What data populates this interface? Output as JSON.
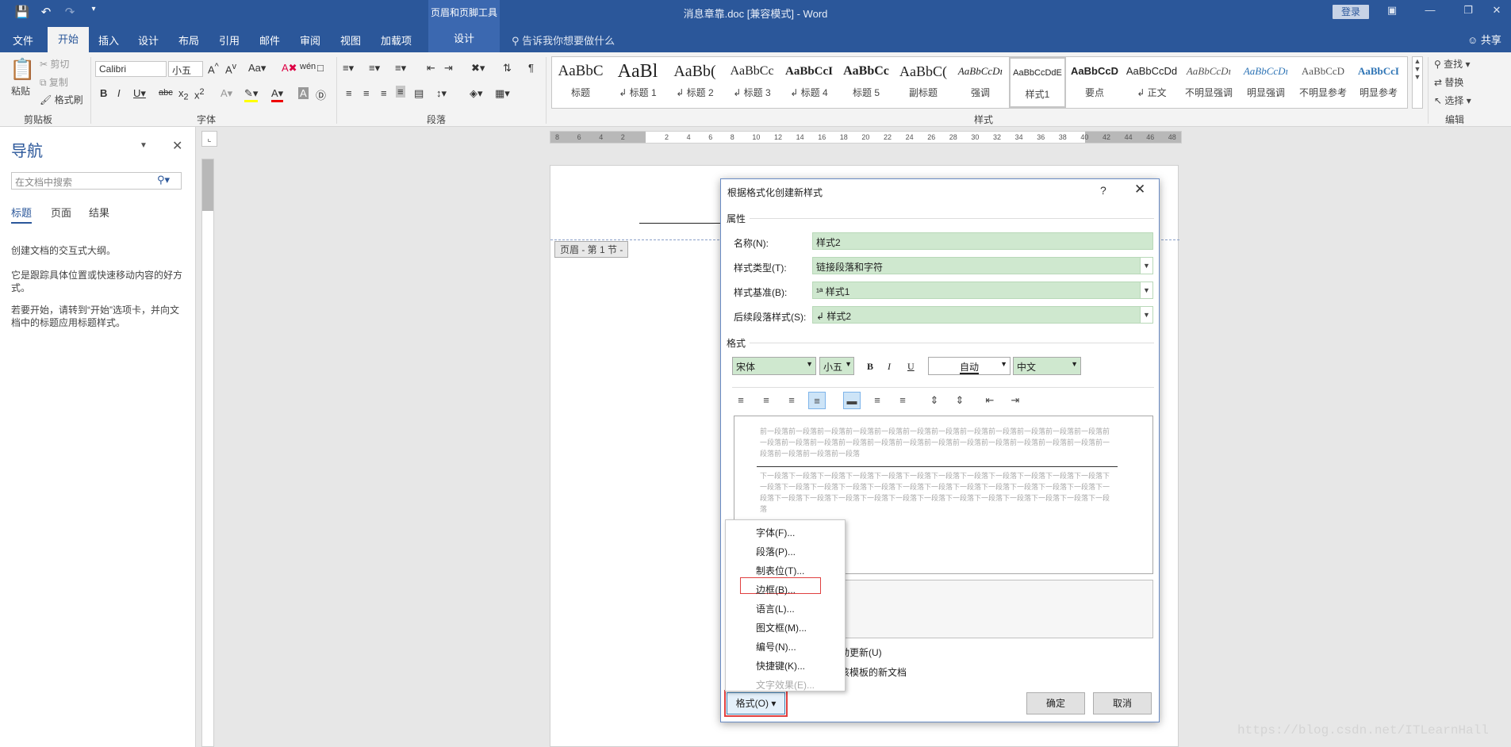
{
  "titlebar": {
    "context_tools": "页眉和页脚工具",
    "doc_title": "消息章靠.doc [兼容模式]  -  Word",
    "login": "登录"
  },
  "tabs": {
    "file": "文件",
    "home": "开始",
    "insert": "插入",
    "design": "设计",
    "layout": "布局",
    "references": "引用",
    "mailings": "邮件",
    "review": "审阅",
    "view": "视图",
    "addins": "加载项",
    "ctx_design": "设计",
    "tell_me": "告诉我你想要做什么",
    "share": "共享"
  },
  "ribbon": {
    "clipboard": {
      "paste": "粘贴",
      "cut": "剪切",
      "copy": "复制",
      "format_painter": "格式刷",
      "label": "剪贴板"
    },
    "font": {
      "name": "Calibri",
      "size": "小五",
      "label": "字体"
    },
    "paragraph": {
      "label": "段落"
    },
    "styles": {
      "label": "样式",
      "items": [
        {
          "sample": "AaBbC",
          "name": "标题"
        },
        {
          "sample": "AaBl",
          "name": "↲ 标题 1"
        },
        {
          "sample": "AaBb(",
          "name": "↲ 标题 2"
        },
        {
          "sample": "AaBbCc",
          "name": "↲ 标题 3"
        },
        {
          "sample": "AaBbCcI",
          "name": "↲ 标题 4"
        },
        {
          "sample": "AaBbCc",
          "name": "标题 5"
        },
        {
          "sample": "AaBbC(",
          "name": "副标题"
        },
        {
          "sample": "AaBbCcDı",
          "name": "强调"
        },
        {
          "sample": "AaBbCcDdE",
          "name": "样式1"
        },
        {
          "sample": "AaBbCcD",
          "name": "要点"
        },
        {
          "sample": "AaBbCcDd",
          "name": "↲ 正文"
        },
        {
          "sample": "AaBbCcDı",
          "name": "不明显强调"
        },
        {
          "sample": "AaBbCcDı",
          "name": "明显强调"
        },
        {
          "sample": "AaBbCcD",
          "name": "不明显参考"
        },
        {
          "sample": "AaBbCcI",
          "name": "明显参考"
        }
      ]
    },
    "editing": {
      "find": "查找",
      "replace": "替换",
      "select": "选择",
      "label": "编辑"
    }
  },
  "nav": {
    "title": "导航",
    "search_placeholder": "在文档中搜索",
    "tabs": [
      "标题",
      "页面",
      "结果"
    ],
    "p1": "创建文档的交互式大纲。",
    "p2": "它是跟踪具体位置或快速移动内容的好方式。",
    "p3": "若要开始，请转到“开始”选项卡，并向文档中的标题应用标题样式。"
  },
  "ruler": {
    "ticks": [
      "8",
      "6",
      "4",
      "2",
      "",
      "2",
      "4",
      "6",
      "8",
      "10",
      "12",
      "14",
      "16",
      "18",
      "20",
      "22",
      "24",
      "26",
      "28",
      "30",
      "32",
      "34",
      "36",
      "38",
      "40",
      "42",
      "44",
      "46",
      "48"
    ]
  },
  "page": {
    "header_tag": "页眉 - 第 1 节 -"
  },
  "dialog": {
    "title": "根据格式化创建新样式",
    "help": "?",
    "section_props": "属性",
    "name_label": "名称(N):",
    "name_value": "样式2",
    "type_label": "样式类型(T):",
    "type_value": "链接段落和字符",
    "base_label": "样式基准(B):",
    "base_value": "¹ª 样式1",
    "next_label": "后续段落样式(S):",
    "next_value": "↲ 样式2",
    "section_format": "格式",
    "font_value": "宋体",
    "size_value": "小五",
    "bold": "B",
    "italic": "I",
    "underline": "U",
    "color_value": "自动",
    "lang_value": "中文",
    "preview_prev": "前一段落前一段落前一段落前一段落前一段落前一段落前一段落前一段落前一段落前一段落前一段落前一段落前一段落前一段落前一段落前一段落前一段落前一段落前一段落前一段落前一段落前一段落前一段落前一段落前一段落前一段落前一段落前一段落",
    "preview_next": "下一段落下一段落下一段落下一段落下一段落下一段落下一段落下一段落下一段落下一段落下一段落下一段落下一段落下一段落下一段落下一段落下一段落下一段落下一段落下一段落下一段落下一段落下一段落下一段落下一段落下一段落下一段落下一段落下一段落下一段落下一段落下一段落下一段落下一段落下一段落下一段落下一段落",
    "auto_update": "动更新(U)",
    "new_template": "该模板的新文档",
    "format_btn": "格式(O) ▾",
    "ok": "确定",
    "cancel": "取消"
  },
  "menu": {
    "items": [
      "字体(F)...",
      "段落(P)...",
      "制表位(T)...",
      "边框(B)...",
      "语言(L)...",
      "图文框(M)...",
      "编号(N)...",
      "快捷键(K)...",
      "文字效果(E)..."
    ]
  },
  "watermark": "https://blog.csdn.net/ITLearnHall"
}
